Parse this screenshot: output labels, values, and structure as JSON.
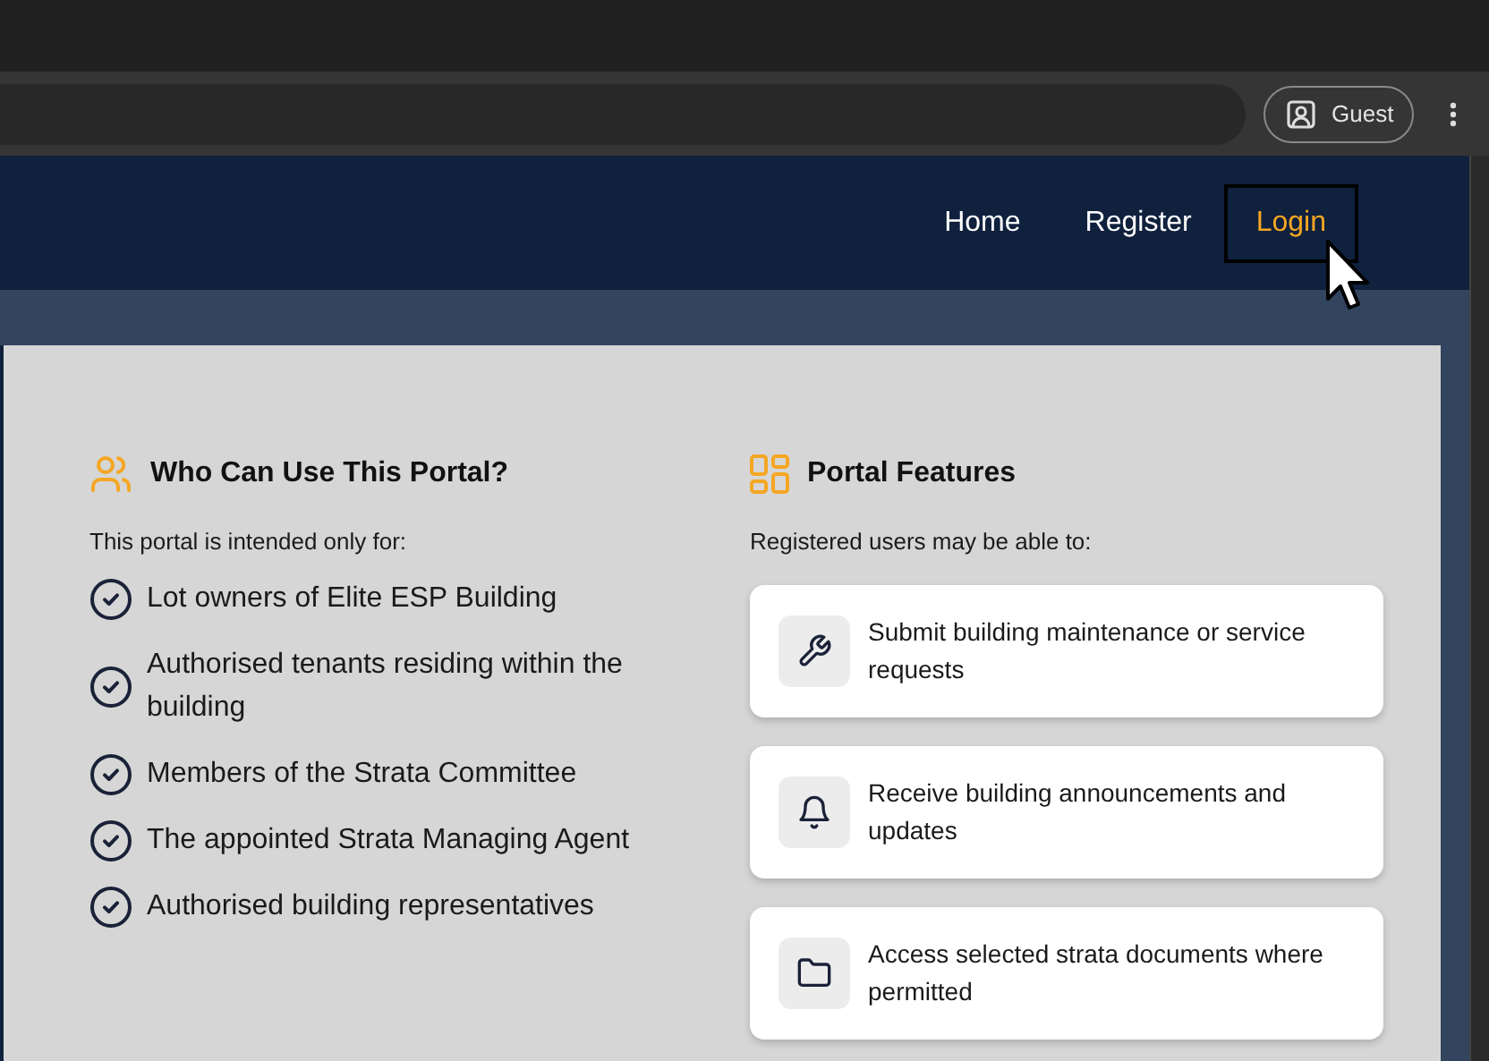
{
  "browser": {
    "profile_button": "Guest"
  },
  "nav": [
    {
      "label": "Home",
      "selected": false
    },
    {
      "label": "Register",
      "selected": false
    },
    {
      "label": "Login",
      "selected": true
    }
  ],
  "audience": {
    "title": "Who Can Use This Portal?",
    "intro": "This portal is intended only for:",
    "items": [
      "Lot owners of Elite ESP Building",
      "Authorised tenants residing within the building",
      "Members of the Strata Committee",
      "The appointed Strata Managing Agent",
      "Authorised building representatives"
    ]
  },
  "features": {
    "title": "Portal Features",
    "intro": "Registered users may be able to:",
    "items": [
      {
        "kind": "wrench",
        "text": "Submit building maintenance or service requests"
      },
      {
        "kind": "bell",
        "text": "Receive building announcements and updates"
      },
      {
        "kind": "folder",
        "text": "Access selected strata documents where permitted"
      }
    ]
  }
}
